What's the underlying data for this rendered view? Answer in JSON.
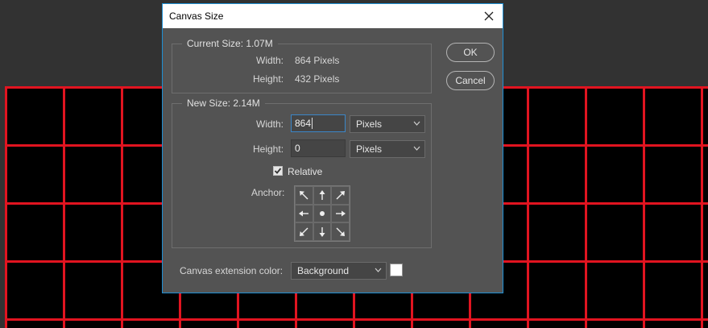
{
  "dialog": {
    "title": "Canvas Size",
    "current_size": {
      "legend": "Current Size: 1.07M",
      "width_label": "Width:",
      "width_value": "864 Pixels",
      "height_label": "Height:",
      "height_value": "432 Pixels"
    },
    "new_size": {
      "legend": "New Size: 2.14M",
      "width_label": "Width:",
      "width_value": "864",
      "width_unit": "Pixels",
      "height_label": "Height:",
      "height_value": "0",
      "height_unit": "Pixels",
      "relative_label": "Relative",
      "relative_checked": true,
      "anchor_label": "Anchor:",
      "anchor_icons": [
        "arrow-up-left",
        "arrow-up",
        "arrow-up-right",
        "arrow-left",
        "anchor-dot",
        "arrow-right",
        "arrow-down-left",
        "arrow-down",
        "arrow-down-right"
      ]
    },
    "extension": {
      "label": "Canvas extension color:",
      "value": "Background",
      "swatch_color": "#ffffff"
    },
    "buttons": {
      "ok": "OK",
      "cancel": "Cancel"
    }
  },
  "colors": {
    "grid_line": "#e11420",
    "grid_fill": "#000000",
    "dialog_bg": "#535353",
    "focus": "#3b86c8"
  }
}
